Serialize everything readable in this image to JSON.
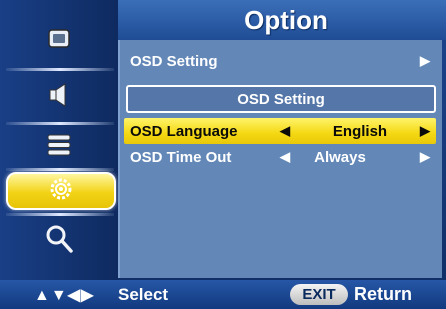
{
  "header": {
    "title": "Option"
  },
  "sidebar": {
    "items": [
      {
        "icon": "display-icon",
        "active": false
      },
      {
        "icon": "speaker-icon",
        "active": false
      },
      {
        "icon": "list-icon",
        "active": false
      },
      {
        "icon": "gear-icon",
        "active": true
      },
      {
        "icon": "magnifier-icon",
        "active": false
      }
    ]
  },
  "menu": {
    "category_label": "OSD Setting",
    "category_arrow": "▶",
    "submenu_title": "OSD Setting",
    "rows": [
      {
        "label": "OSD Language",
        "value": "English",
        "left_arrow": "◀",
        "right_arrow": "▶",
        "selected": true
      },
      {
        "label": "OSD Time Out",
        "value": "Always",
        "left_arrow": "◀",
        "right_arrow": "▶",
        "selected": false
      }
    ]
  },
  "footer": {
    "nav_arrows": "▲▼◀▶",
    "select_label": "Select",
    "exit_button": "EXIT",
    "return_label": "Return"
  },
  "colors": {
    "highlight": "#f4d813",
    "panel": "#6388b8",
    "background": "#163a7a"
  }
}
